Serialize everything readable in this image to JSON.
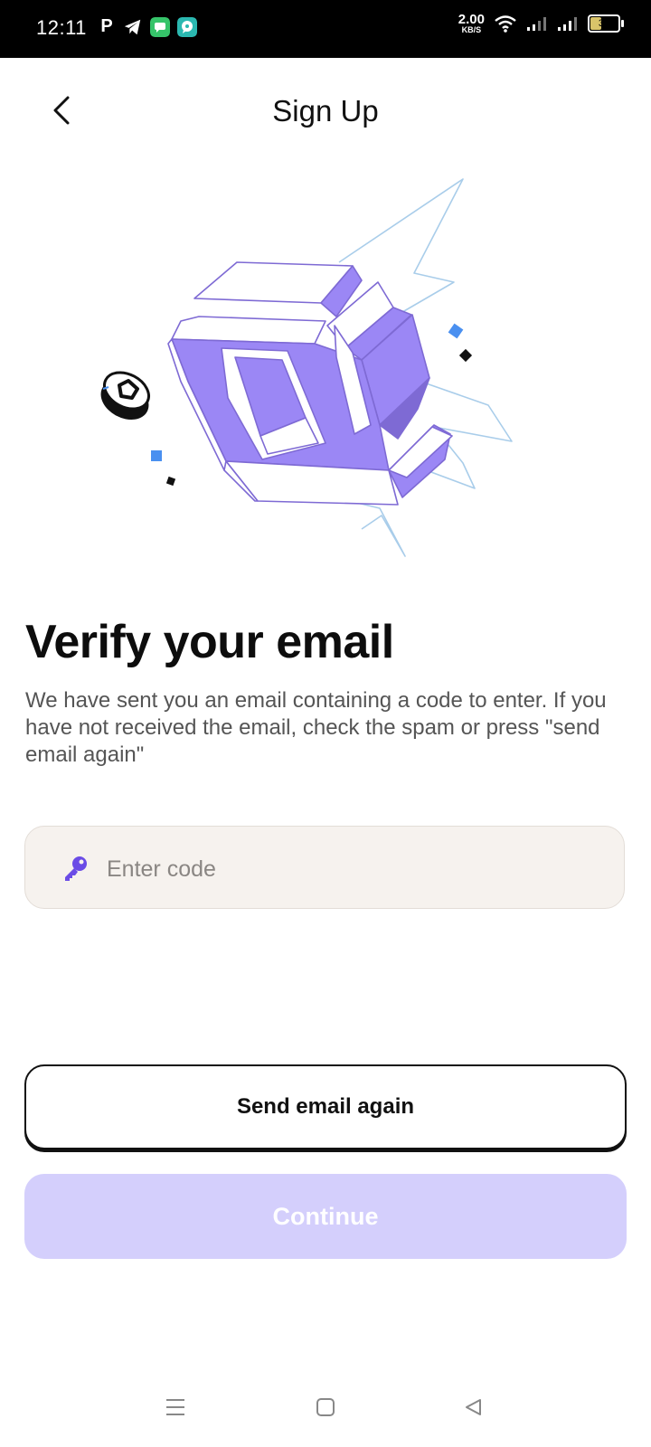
{
  "status_bar": {
    "time": "12:11",
    "net_speed_value": "2.00",
    "net_speed_unit": "KB/S",
    "battery_level": "39",
    "icons": [
      "parking-app-icon",
      "telegram-icon",
      "messages-icon",
      "chat-app-icon",
      "wifi-icon",
      "signal-icon",
      "signal-icon",
      "battery-icon"
    ]
  },
  "header": {
    "title": "Sign Up",
    "back_icon": "chevron-left-icon"
  },
  "illustration": {
    "name": "3d-logo-illustration",
    "accent_color": "#9b87f5",
    "line_color": "#a9cdea",
    "square_color": "#4a90f0"
  },
  "main": {
    "heading": "Verify your email",
    "description": "We have sent you an email containing a code to enter. If you have not received the email, check the spam or press \"send email again\"",
    "code_input": {
      "placeholder": "Enter code",
      "value": "",
      "icon": "key-icon",
      "icon_color": "#6b4ce6"
    }
  },
  "buttons": {
    "send_again_label": "Send email again",
    "continue_label": "Continue",
    "continue_color": "#d4cffc"
  },
  "nav_bar": {
    "items": [
      "menu-icon",
      "home-icon",
      "back-icon"
    ]
  }
}
